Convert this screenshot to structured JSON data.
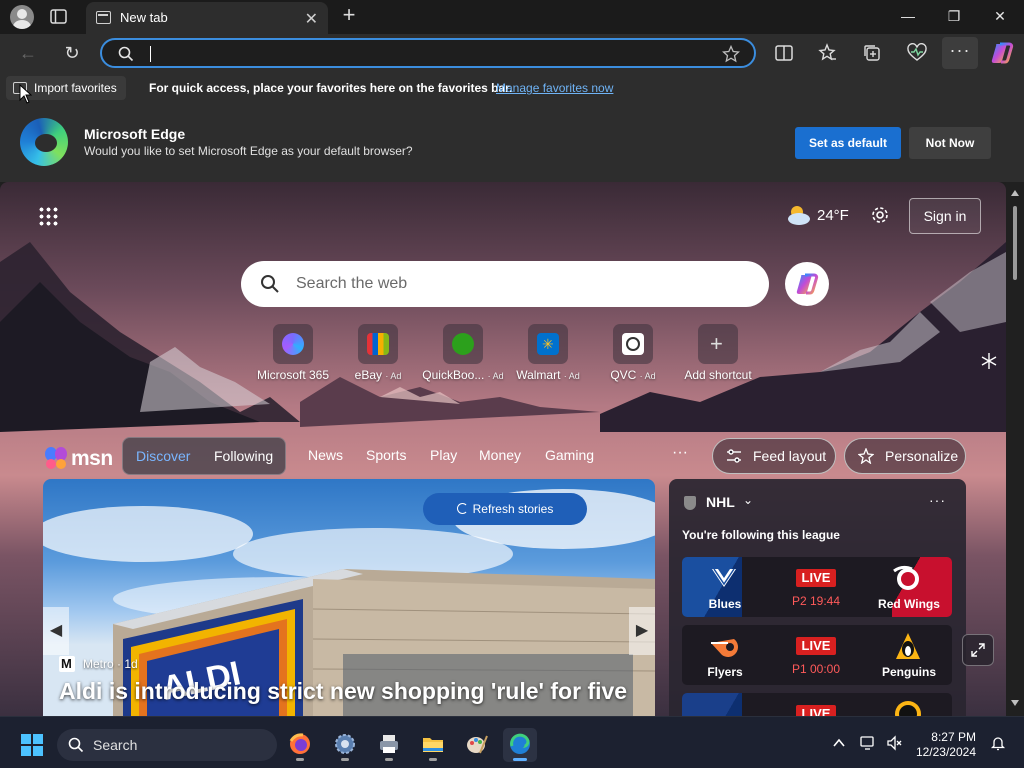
{
  "window": {
    "tab_title": "New tab",
    "tab_close_glyph": "✕",
    "new_tab_glyph": "+",
    "minimize_glyph": "—",
    "restore_glyph": "❐",
    "close_glyph": "✕"
  },
  "nav": {
    "back_glyph": "←",
    "refresh_glyph": "↻",
    "address_value": "",
    "more_glyph": "···"
  },
  "favorites_bar": {
    "import_label": "Import favorites",
    "message": "For quick access, place your favorites here on the favorites bar.",
    "link": "Manage favorites now"
  },
  "infobar": {
    "title": "Microsoft Edge",
    "subtitle": "Would you like to set Microsoft Edge as your default browser?",
    "set_default": "Set as default",
    "not_now": "Not Now"
  },
  "ntp": {
    "weather_temp": "24°F",
    "sign_in": "Sign in",
    "search_placeholder": "Search the web",
    "tiles": [
      {
        "label": "Microsoft 365",
        "ad": "",
        "icon": "microsoft-365-icon",
        "color": "#5b5fc7"
      },
      {
        "label": "eBay",
        "ad": "· Ad",
        "icon": "ebay-icon",
        "color": "#e53238"
      },
      {
        "label": "QuickBoo...",
        "ad": "· Ad",
        "icon": "quickbooks-icon",
        "color": "#2ca01c"
      },
      {
        "label": "Walmart",
        "ad": "· Ad",
        "icon": "walmart-icon",
        "color": "#0071ce"
      },
      {
        "label": "QVC",
        "ad": "· Ad",
        "icon": "qvc-icon",
        "color": "#ffffff"
      },
      {
        "label": "Add shortcut",
        "ad": "",
        "icon": "plus-icon",
        "color": "#5a5a5a"
      }
    ]
  },
  "feed": {
    "logo_text": "msn",
    "pill_tabs": [
      "Discover",
      "Following"
    ],
    "tabs": [
      "News",
      "Sports",
      "Play",
      "Money",
      "Gaming"
    ],
    "more_glyph": "···",
    "feed_layout": "Feed layout",
    "personalize": "Personalize"
  },
  "hero": {
    "refresh": "Refresh stories",
    "source": "Metro",
    "age": "1d",
    "headline": "Aldi is introducing strict new shopping 'rule' for five",
    "prev_glyph": "◀",
    "next_glyph": "▶"
  },
  "nhl": {
    "title": "NHL",
    "subtitle": "You're following this league",
    "more_glyph": "···",
    "games": [
      {
        "home": "Blues",
        "away": "Red Wings",
        "status": "LIVE",
        "clock": "P2 19:44",
        "home_color": "#1a4fa0",
        "away_color": "#c8102e"
      },
      {
        "home": "Flyers",
        "away": "Penguins",
        "status": "LIVE",
        "clock": "P1 00:00",
        "home_color": "#1d1a22",
        "away_color": "#1d1a22"
      },
      {
        "home": "",
        "away": "",
        "status": "LIVE",
        "clock": "",
        "home_color": "#1a3f8a",
        "away_color": "#1d1a22"
      }
    ]
  },
  "taskbar": {
    "search": "Search",
    "time": "8:27 PM",
    "date": "12/23/2024"
  },
  "colors": {
    "accent": "#1a6fd0",
    "link": "#6fb3f5",
    "live": "#d82020"
  }
}
